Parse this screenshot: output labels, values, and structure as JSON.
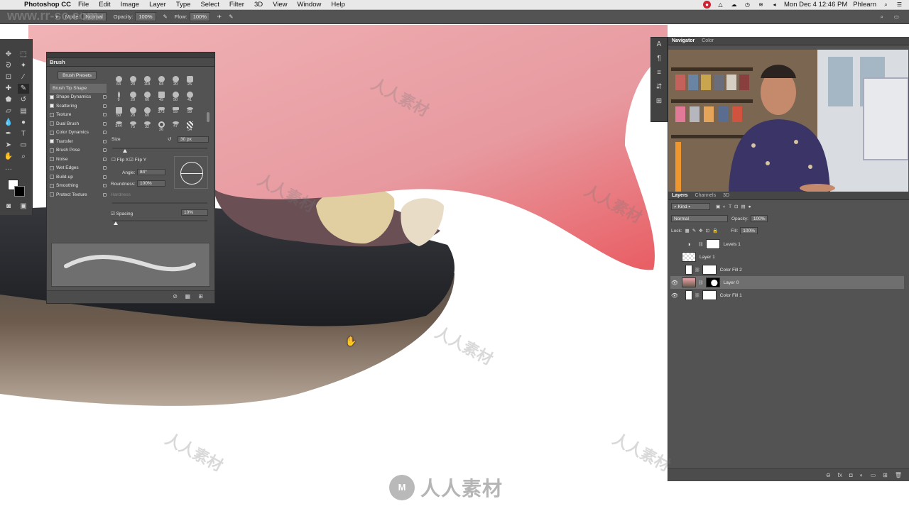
{
  "menubar": {
    "app_name": "Photoshop CC",
    "menus": [
      "File",
      "Edit",
      "Image",
      "Layer",
      "Type",
      "Select",
      "Filter",
      "3D",
      "View",
      "Window",
      "Help"
    ],
    "datetime": "Mon Dec 4  12:46 PM",
    "user": "Phlearn"
  },
  "options_bar": {
    "mode_label": "Mode:",
    "mode_value": "Normal",
    "opacity_label": "Opacity:",
    "opacity_value": "100%",
    "flow_label": "Flow:",
    "flow_value": "100%"
  },
  "brush_panel": {
    "tab": "Brush",
    "presets_button": "Brush Presets",
    "options": [
      {
        "label": "Brush Tip Shape",
        "checked": false,
        "highlight": true
      },
      {
        "label": "Shape Dynamics",
        "checked": true
      },
      {
        "label": "Scattering",
        "checked": true
      },
      {
        "label": "Texture",
        "checked": false
      },
      {
        "label": "Dual Brush",
        "checked": false
      },
      {
        "label": "Color Dynamics",
        "checked": false
      },
      {
        "label": "Transfer",
        "checked": true
      },
      {
        "label": "Brush Pose",
        "checked": false
      },
      {
        "label": "Noise",
        "checked": false
      },
      {
        "label": "Wet Edges",
        "checked": false
      },
      {
        "label": "Build-up",
        "checked": false
      },
      {
        "label": "Smoothing",
        "checked": false
      },
      {
        "label": "Protect Texture",
        "checked": false
      }
    ],
    "tip_sizes": [
      "64",
      "20",
      "118",
      "64",
      "20",
      "25",
      "9",
      "20",
      "60",
      "49",
      "50",
      "41",
      "50",
      "20",
      "60",
      "373",
      "59",
      "59",
      "344",
      "75",
      "32",
      "26",
      "47",
      "54"
    ],
    "size_label": "Size",
    "size_value": "30 px",
    "flip_x": "Flip X",
    "flip_y": "Flip Y",
    "angle_label": "Angle:",
    "angle_value": "84°",
    "roundness_label": "Roundness:",
    "roundness_value": "100%",
    "hardness_label": "Hardness",
    "spacing_label": "Spacing",
    "spacing_value": "10%"
  },
  "navigator": {
    "tabs": [
      "Navigator",
      "Color"
    ]
  },
  "layers_panel": {
    "tabs": [
      "Layers",
      "Channels",
      "3D"
    ],
    "kind_label": "Kind",
    "blend_mode": "Normal",
    "opacity_label": "Opacity:",
    "opacity_value": "100%",
    "lock_label": "Lock:",
    "fill_label": "Fill:",
    "fill_value": "100%",
    "layers": [
      {
        "name": "Levels 1",
        "visible": false,
        "selected": false
      },
      {
        "name": "Layer 1",
        "visible": false,
        "selected": false
      },
      {
        "name": "Color Fill 2",
        "visible": false,
        "selected": false
      },
      {
        "name": "Layer 0",
        "visible": true,
        "selected": true
      },
      {
        "name": "Color Fill 1",
        "visible": true,
        "selected": false
      }
    ]
  },
  "watermark": {
    "url": "www.rr-sc.com",
    "text": "人人素材"
  },
  "colors": {
    "panel_bg": "#535353",
    "tongue": "#e9a2a8",
    "lip_dark": "#2a2a2e"
  }
}
